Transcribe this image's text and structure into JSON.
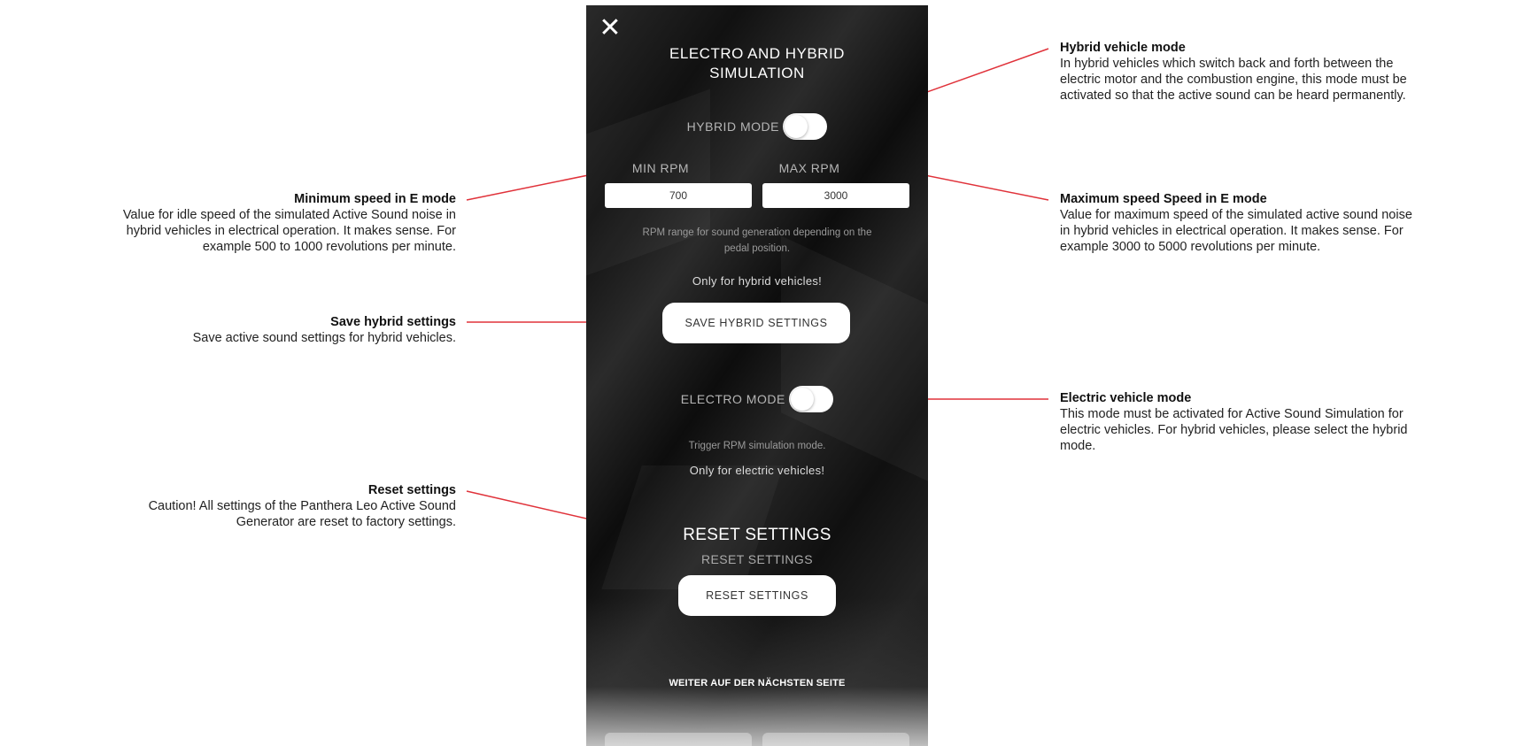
{
  "screen": {
    "title_line1": "ELECTRO AND HYBRID",
    "title_line2": "SIMULATION",
    "close_glyph": "✕",
    "hybrid_mode_label": "HYBRID MODE",
    "min_rpm_label": "MIN RPM",
    "max_rpm_label": "MAX RPM",
    "min_rpm_value": "700",
    "max_rpm_value": "3000",
    "rpm_note_line1": "RPM range for sound generation depending on the",
    "rpm_note_line2": "pedal position.",
    "hybrid_only": "Only for hybrid vehicles!",
    "save_hybrid_button": "SAVE HYBRID SETTINGS",
    "electro_mode_label": "ELECTRO MODE",
    "trigger_note": "Trigger RPM simulation mode.",
    "electric_only": "Only for electric vehicles!",
    "reset_title": "RESET SETTINGS",
    "reset_subtitle": "RESET SETTINGS",
    "reset_button": "RESET SETTINGS",
    "continue_text": "WEITER AUF DER NÄCHSTEN SEITE"
  },
  "annotations": {
    "hybrid_mode": {
      "heading": "Hybrid vehicle mode",
      "line1": "In hybrid vehicles which switch back and forth between the",
      "line2": "electric motor and the combustion engine, this mode must be",
      "line3": "activated so that the active sound can be heard permanently."
    },
    "min_speed": {
      "heading": "Minimum speed in E mode",
      "line1": "Value for idle speed of the simulated Active Sound noise in",
      "line2": "hybrid vehicles in electrical operation. It makes sense. For",
      "line3": "example 500 to 1000 revolutions per minute."
    },
    "max_speed": {
      "heading": "Maximum speed Speed in E mode",
      "line1": "Value for maximum speed of the simulated active sound noise",
      "line2": "in hybrid vehicles in electrical operation. It makes sense. For",
      "line3": "example 3000 to 5000 revolutions per minute."
    },
    "save_hybrid": {
      "heading": "Save hybrid settings",
      "line1": "Save active sound settings for hybrid vehicles."
    },
    "electric_mode": {
      "heading": "Electric vehicle mode",
      "line1": "This mode must be activated for Active Sound Simulation for",
      "line2": "electric vehicles. For hybrid vehicles, please select the hybrid",
      "line3": "mode."
    },
    "reset": {
      "heading": "Reset settings",
      "line1": "Caution! All settings of the Panthera Leo Active Sound",
      "line2": "Generator are reset to factory settings."
    }
  },
  "colors": {
    "callout_line": "#e0323a",
    "screen_background": "#1a1a1a",
    "button_background": "#ffffff"
  },
  "icons": {
    "close": "close-icon"
  }
}
